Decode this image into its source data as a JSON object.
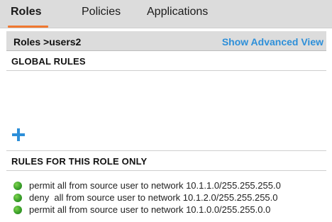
{
  "tabs": [
    {
      "label": "Roles",
      "active": true
    },
    {
      "label": "Policies",
      "active": false
    },
    {
      "label": "Applications",
      "active": false
    }
  ],
  "header": {
    "breadcrumb": "Roles >users2",
    "advanced_link": "Show Advanced View"
  },
  "global_rules": {
    "title": "GLOBAL RULES",
    "add_icon": "plus-icon"
  },
  "role_rules": {
    "title": "RULES FOR THIS ROLE ONLY",
    "items": [
      {
        "text": "permit all from source user to network 10.1.1.0/255.255.255.0",
        "status": "green"
      },
      {
        "text": "deny  all from source user to network 10.1.2.0/255.255.255.0",
        "status": "green"
      },
      {
        "text": "permit all from source user to network 10.1.0.0/255.255.0.0",
        "status": "green"
      }
    ]
  },
  "colors": {
    "accent": "#2d8fd9",
    "tab_underline": "#f07830",
    "bar_background": "#dcdcdc",
    "status_green": "#3aa02a"
  }
}
